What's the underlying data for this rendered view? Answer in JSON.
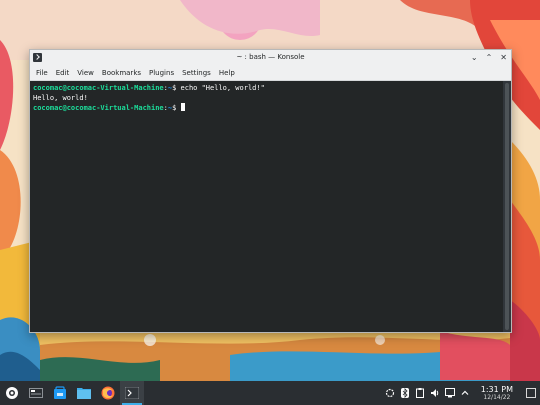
{
  "window": {
    "title": "~ : bash — Konsole",
    "controls": {
      "minimize": "⌄",
      "maximize": "⌃",
      "close": "✕"
    }
  },
  "menu": [
    "File",
    "Edit",
    "View",
    "Bookmarks",
    "Plugins",
    "Settings",
    "Help"
  ],
  "terminal": {
    "line1_user": "cocomac@cocomac-Virtual-Machine",
    "line1_sep": ":",
    "line1_path": "~",
    "line1_cmd": "$ echo \"Hello, world!\"",
    "line2_output": "Hello, world!",
    "line3_user": "cocomac@cocomac-Virtual-Machine",
    "line3_sep": ":",
    "line3_path": "~",
    "line3_cmd": "$ "
  },
  "taskbar": {
    "apps": [
      "application-launcher-icon",
      "pager-icon",
      "discover-icon",
      "dolphin-icon",
      "firefox-icon",
      "konsole-icon"
    ],
    "clock": {
      "time": "1:31 PM",
      "date": "12/14/22"
    }
  },
  "colors": {
    "accent": "#3daee9",
    "prompt_user": "#1cdc9a",
    "prompt_path": "#1d99f3"
  }
}
